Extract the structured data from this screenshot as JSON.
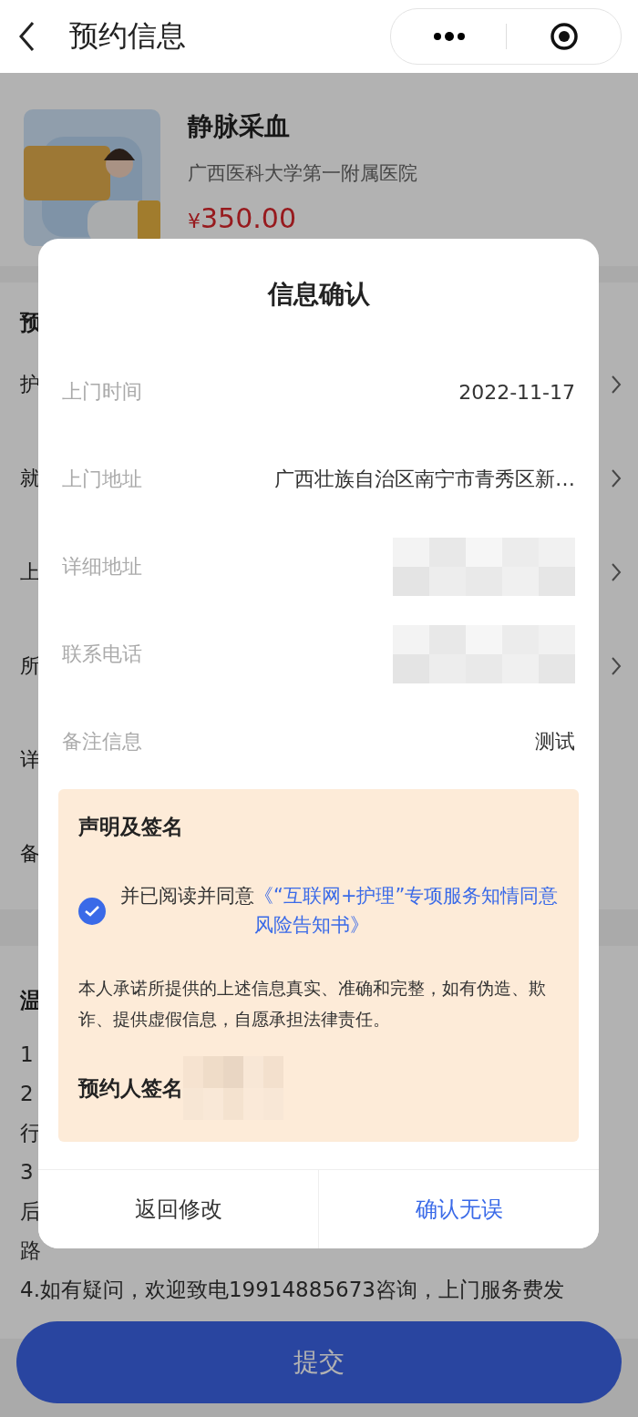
{
  "header": {
    "title": "预约信息"
  },
  "product": {
    "title": "静脉采血",
    "hospital": "广西医科大学第一附属医院",
    "currency": "¥",
    "price": "350.00"
  },
  "form": {
    "heading": "预",
    "rows": [
      {
        "label": "护",
        "chevron": true
      },
      {
        "label": "就",
        "chevron": true
      },
      {
        "label": "上",
        "chevron": true
      },
      {
        "label": "所",
        "chevron": true
      },
      {
        "label": "详",
        "chevron": false
      },
      {
        "label": "备",
        "chevron": false
      }
    ]
  },
  "tips": {
    "heading": "温",
    "lines": [
      "1",
      "2",
      "行",
      "3",
      "后",
      "路",
      "4.如有疑问，欢迎致电19914885673咨询，上门服务费发"
    ]
  },
  "submit": "提交",
  "dialog": {
    "title": "信息确认",
    "fields": [
      {
        "label": "上门时间",
        "kind": "text",
        "value": "2022-11-17"
      },
      {
        "label": "上门地址",
        "kind": "text",
        "value": "广西壮族自治区南宁市青秀区新…"
      },
      {
        "label": "详细地址",
        "kind": "blurred"
      },
      {
        "label": "联系电话",
        "kind": "blurred"
      },
      {
        "label": "备注信息",
        "kind": "text",
        "value": "测试"
      }
    ],
    "declaration": {
      "title": "声明及签名",
      "checked": true,
      "agree_prefix": "并已阅读并同意",
      "agree_link": "《“互联网+护理”专项服务知情同意风险告知书》",
      "pledge": "本人承诺所提供的上述信息真实、准确和完整，如有伪造、欺诈、提供虚假信息，自愿承担法律责任。",
      "signature_label": "预约人签名"
    },
    "buttons": [
      {
        "label": "返回修改",
        "kind": "cancel"
      },
      {
        "label": "确认无误",
        "kind": "confirm"
      }
    ]
  }
}
